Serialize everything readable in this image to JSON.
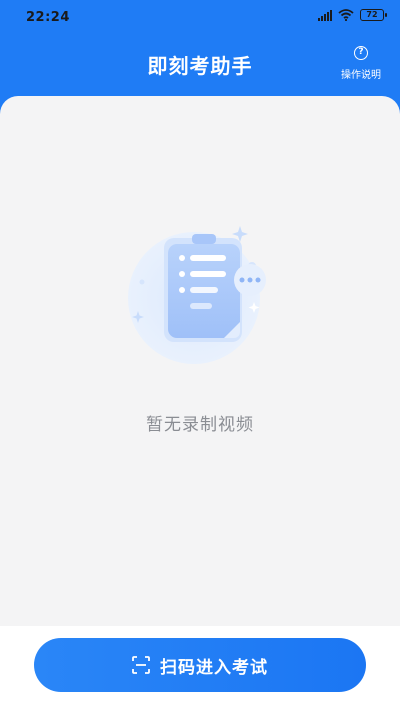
{
  "status_bar": {
    "time": "22:24",
    "battery": "72"
  },
  "header": {
    "title": "即刻考助手",
    "help_label": "操作说明"
  },
  "empty_state": {
    "message": "暂无录制视频"
  },
  "footer": {
    "scan_button_label": "扫码进入考试"
  },
  "colors": {
    "primary": "#1f7cf5",
    "background": "#f4f4f5",
    "empty_text": "#8a8d93"
  },
  "icons": {
    "signal": "signal-icon",
    "wifi": "wifi-icon",
    "battery": "battery-icon",
    "help": "question-circle-icon",
    "empty": "clipboard-document-icon",
    "scan": "scan-qr-icon"
  }
}
